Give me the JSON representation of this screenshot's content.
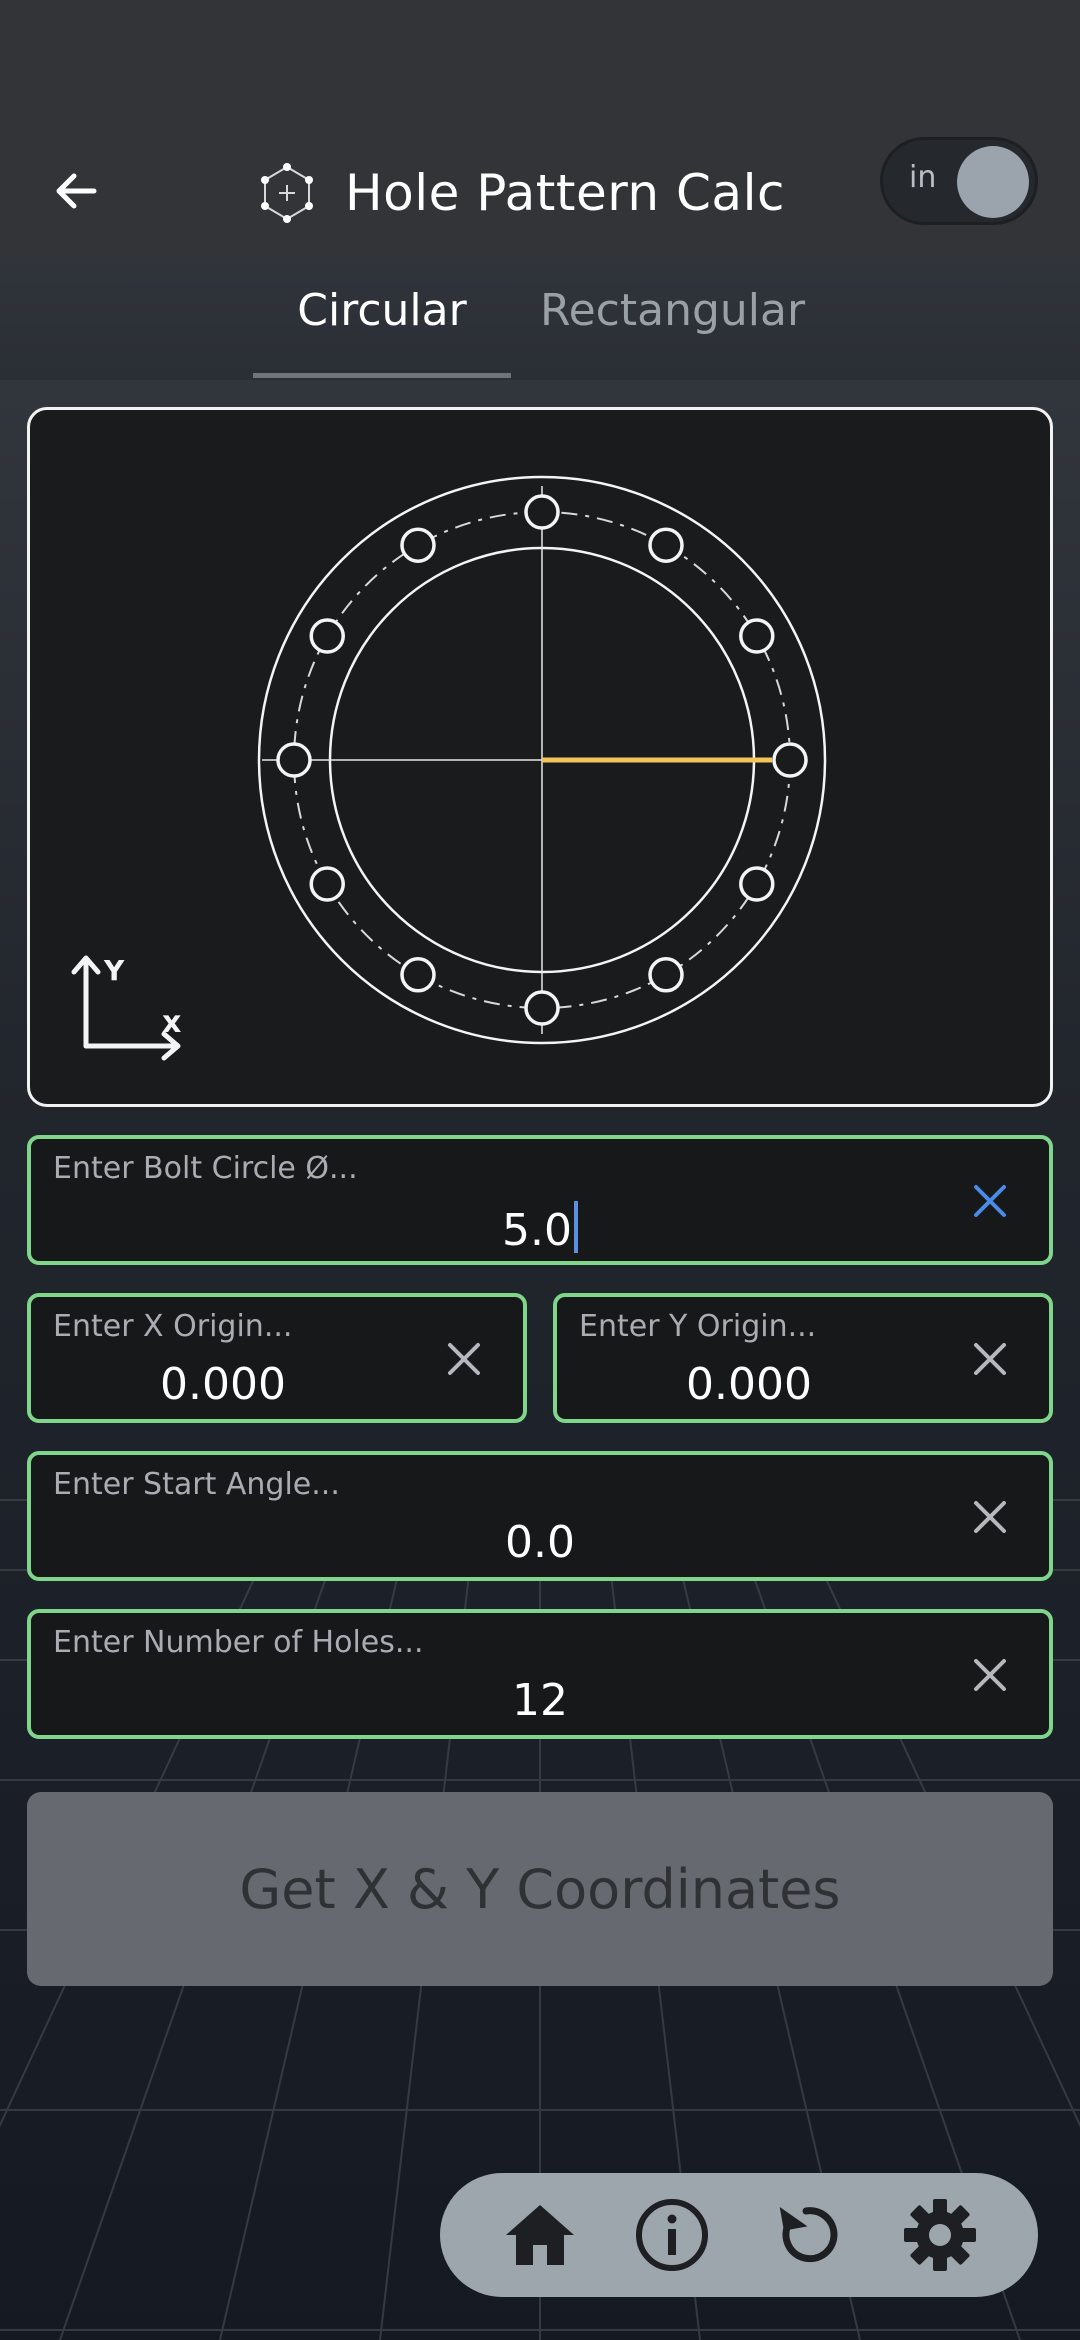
{
  "app": {
    "title": "Hole Pattern Calc",
    "unit_toggle": "in"
  },
  "tabs": [
    {
      "label": "Circular",
      "active": true
    },
    {
      "label": "Rectangular",
      "active": false
    }
  ],
  "preview": {
    "number_of_holes": 12,
    "axis_y_label": "Y",
    "axis_x_label": "x"
  },
  "fields": {
    "bolt_circle": {
      "placeholder": "Enter Bolt Circle Ø...",
      "value": "5.0"
    },
    "x_origin": {
      "placeholder": "Enter X Origin...",
      "value": "0.000"
    },
    "y_origin": {
      "placeholder": "Enter Y Origin...",
      "value": "0.000"
    },
    "start_angle": {
      "placeholder": "Enter Start Angle...",
      "value": "0.0"
    },
    "num_holes": {
      "placeholder": "Enter Number of Holes...",
      "value": "12"
    }
  },
  "actions": {
    "get_coordinates": "Get X & Y Coordinates"
  },
  "nav": [
    {
      "icon": "home-icon"
    },
    {
      "icon": "info-icon"
    },
    {
      "icon": "reset-icon"
    },
    {
      "icon": "settings-icon"
    }
  ],
  "colors": {
    "field_border": "#7fd68a",
    "radius_line": "#f2c45a",
    "clear_active": "#4a8be8"
  }
}
